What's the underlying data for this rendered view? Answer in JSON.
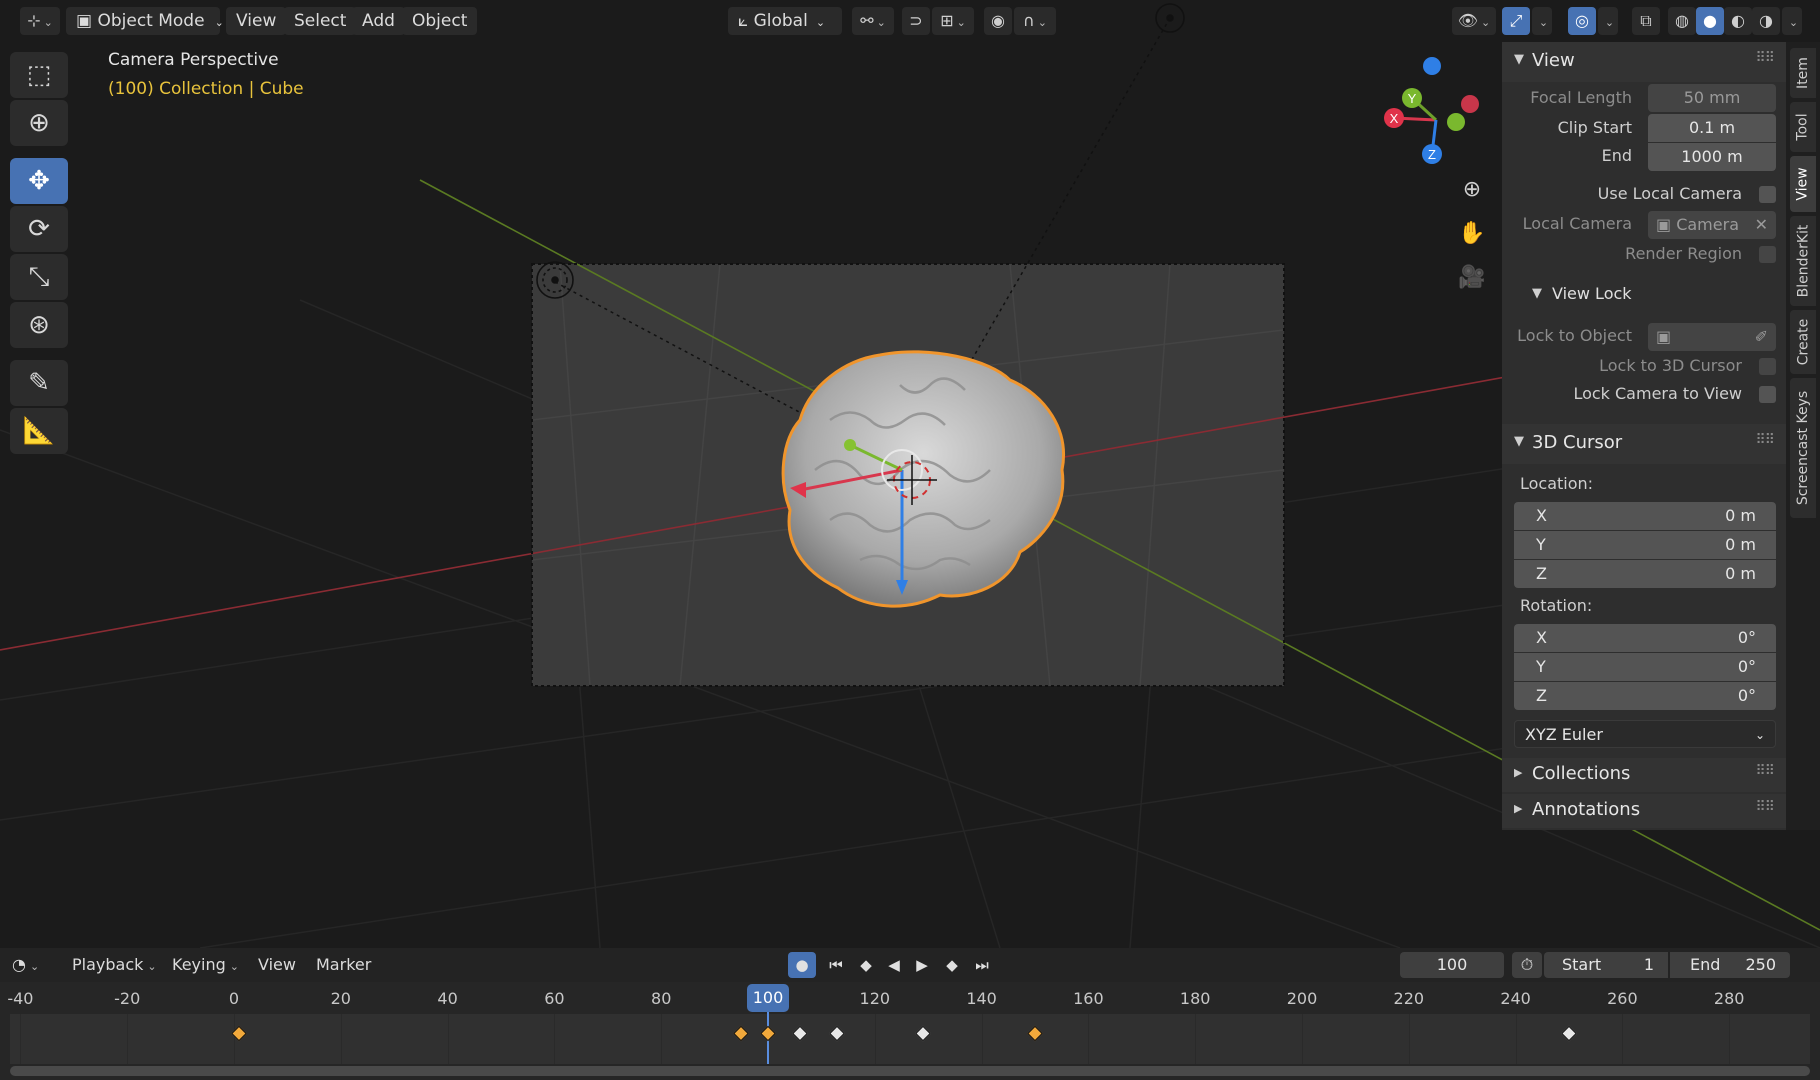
{
  "header": {
    "mode": "Object Mode",
    "menus": [
      "View",
      "Select",
      "Add",
      "Object"
    ],
    "orientation": "Global"
  },
  "viewport": {
    "perspective": "Camera Perspective",
    "collection": "(100) Collection | Cube",
    "gizmo_labels": {
      "x": "X",
      "y": "Y",
      "z": "Z"
    }
  },
  "panel": {
    "view": {
      "title": "View",
      "focal_length_label": "Focal Length",
      "focal_length": "50 mm",
      "clip_start_label": "Clip Start",
      "clip_start": "0.1 m",
      "end_label": "End",
      "end": "1000 m",
      "use_local_camera": "Use Local Camera",
      "local_camera_label": "Local Camera",
      "local_camera_value": "Camera",
      "render_region": "Render Region"
    },
    "view_lock": {
      "title": "View Lock",
      "lock_to_object": "Lock to Object",
      "lock_to_cursor": "Lock to 3D Cursor",
      "lock_camera": "Lock Camera to View"
    },
    "cursor": {
      "title": "3D Cursor",
      "location_label": "Location:",
      "location": [
        {
          "axis": "X",
          "value": "0 m"
        },
        {
          "axis": "Y",
          "value": "0 m"
        },
        {
          "axis": "Z",
          "value": "0 m"
        }
      ],
      "rotation_label": "Rotation:",
      "rotation": [
        {
          "axis": "X",
          "value": "0°"
        },
        {
          "axis": "Y",
          "value": "0°"
        },
        {
          "axis": "Z",
          "value": "0°"
        }
      ],
      "rotation_mode": "XYZ Euler"
    },
    "collections": "Collections",
    "annotations": "Annotations"
  },
  "tabs": [
    "Item",
    "Tool",
    "View",
    "BlenderKit",
    "Create",
    "Screencast Keys"
  ],
  "timeline": {
    "menus": {
      "playback": "Playback",
      "keying": "Keying",
      "view": "View",
      "marker": "Marker"
    },
    "current_frame": "100",
    "start_label": "Start",
    "start": "1",
    "end_label": "End",
    "end": "250",
    "ticks": [
      "-40",
      "-20",
      "0",
      "20",
      "40",
      "60",
      "80",
      "100",
      "120",
      "140",
      "160",
      "180",
      "200",
      "220",
      "240",
      "260",
      "280"
    ],
    "playhead": "100"
  },
  "colors": {
    "accent": "#4772b3",
    "selection": "#f2a93b",
    "collection_text": "#e8c33c"
  }
}
